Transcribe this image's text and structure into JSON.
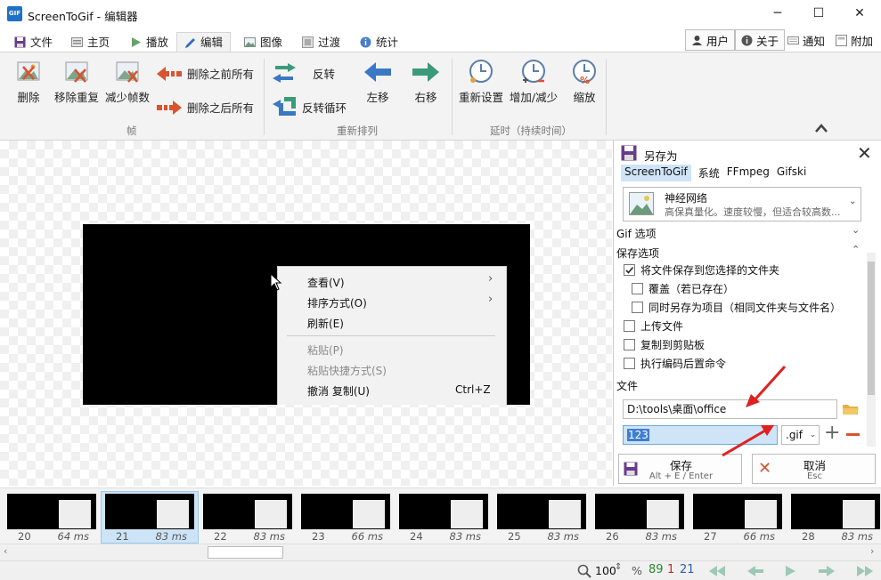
{
  "window": {
    "app_icon": "GIF",
    "title": "ScreenToGif - 编辑器",
    "minimize": "─",
    "maximize": "☐",
    "close": "✕"
  },
  "tabs": [
    {
      "label": "文件",
      "icon": "save-icon"
    },
    {
      "label": "主页",
      "icon": "home-icon"
    },
    {
      "label": "播放",
      "icon": "play-icon"
    },
    {
      "label": "编辑",
      "icon": "pencil-icon"
    },
    {
      "label": "图像",
      "icon": "image-icon"
    },
    {
      "label": "过渡",
      "icon": "transition-icon"
    },
    {
      "label": "统计",
      "icon": "info-icon"
    }
  ],
  "right_tabs": {
    "user": "用户",
    "about": "关于",
    "notify": "通知",
    "attach": "附加"
  },
  "ribbon": {
    "frames": {
      "delete": "删除",
      "remove_duplicates": "移除重复",
      "reduce": "减少帧数",
      "delete_before": "删除之前所有",
      "delete_after": "删除之后所有",
      "group": "帧"
    },
    "reorder": {
      "reverse": "反转",
      "yoyo": "反转循环",
      "move_left": "左移",
      "move_right": "右移",
      "group": "重新排列"
    },
    "delay": {
      "override": "重新设置",
      "increase": "增加/减少",
      "scale": "缩放",
      "group": "延时（持续时间）"
    },
    "colors": {
      "left_arrow": "#3a78c4",
      "right_arrow": "#3a9a7a",
      "red": "#d9532c"
    }
  },
  "context_menu": {
    "view": "查看(V)",
    "sort": "排序方式(O)",
    "refresh": "刷新(E)",
    "paste": "粘贴(P)",
    "paste_shortcut": "粘贴快捷方式(S)",
    "undo": "撤消 复制(U)",
    "undo_key": "Ctrl+Z"
  },
  "save_panel": {
    "title": "另存为",
    "encoder_tabs": [
      "ScreenToGif",
      "系统",
      "FFmpeg",
      "Gifski"
    ],
    "preset_title": "神经网络",
    "preset_desc": "高保真量化。速度较慢，但适合较高数...",
    "gif_options": "Gif 选项",
    "save_options": "保存选项",
    "opt_save_to_folder": "将文件保存到您选择的文件夹",
    "opt_overwrite": "覆盖（若已存在）",
    "opt_save_project": "同时另存为项目（相同文件夹与文件名）",
    "opt_upload": "上传文件",
    "opt_clipboard": "复制到剪贴板",
    "opt_post_command": "执行编码后置命令",
    "file_label": "文件",
    "folder_value": "D:\\tools\\桌面\\office",
    "filename_value": "123",
    "extension": ".gif",
    "save": "保存",
    "save_shortcut": "Alt + E / Enter",
    "cancel": "取消",
    "cancel_shortcut": "Esc"
  },
  "frames": [
    {
      "num": "20",
      "ms": "64 ms"
    },
    {
      "num": "21",
      "ms": "83 ms"
    },
    {
      "num": "22",
      "ms": "83 ms"
    },
    {
      "num": "23",
      "ms": "66 ms"
    },
    {
      "num": "24",
      "ms": "83 ms"
    },
    {
      "num": "25",
      "ms": "83 ms"
    },
    {
      "num": "26",
      "ms": "83 ms"
    },
    {
      "num": "27",
      "ms": "66 ms"
    },
    {
      "num": "28",
      "ms": "83 ms"
    }
  ],
  "status": {
    "zoom": "100",
    "zoom_unit": "%",
    "total": "89",
    "selected": "1",
    "current": "21"
  }
}
